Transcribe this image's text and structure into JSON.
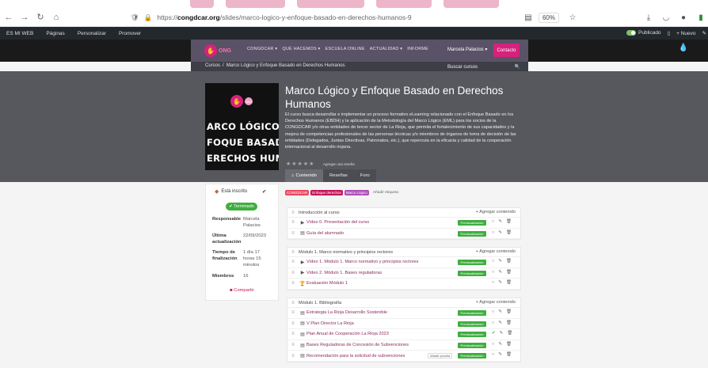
{
  "browser": {
    "url_prefix": "https://",
    "url_domain": "congdcar.org",
    "url_path": "/slides/marco-logico-y-enfoque-basado-en-derechos-humanos-9",
    "zoom": "60%"
  },
  "wpbar": {
    "site_item": "ES MI WEB",
    "items": [
      "Páginas",
      "Personalizar",
      "Promover"
    ],
    "published": "Publicado",
    "new_label": "+ Nuevo"
  },
  "header": {
    "logo_text": "ONG",
    "menu": [
      "CONGDCAR ▾",
      "QUÉ HACEMOS ▾",
      "ESCUELA ONLINE",
      "ACTUALIDAD ▾",
      "INFORME"
    ],
    "user": "Marcela Palacios ▾",
    "contact": "Contacto"
  },
  "breadcrumb": {
    "root": "Cursos",
    "sep": "/",
    "current": "Marco Lógico y Enfoque Basado en Derechos Humanos"
  },
  "search": {
    "placeholder": "Buscar cursos"
  },
  "cover": {
    "logo_text": "ONG",
    "line1": "ARCO LÓGICO",
    "line2": "FOQUE BASADO",
    "line3": "ERECHOS HUMAN"
  },
  "course": {
    "title": "Marco Lógico y Enfoque Basado en Derechos Humanos",
    "description": "El curso busca desarrollar e implementar un proceso formativo eLearning relacionado con el Enfoque Basado en los Derechos Humanos (EBDH) y la aplicación de la Metodología del Marco Lógico (EML) para los socios de la CONGDCAR y/o otras entidades de tercer sector de La Rioja, que permita el fortalecimiento de sus capacidades y la mejora de competencias profesionales de las personas técnicas y/o miembros de órganos de toma de decisión de las entidades (Delegados, Juntas Directivas, Patronatos, etc.), que repercuta en la eficacia y calidad de la cooperación internacional al desarrollo riojana.",
    "rate_label": "Agregar una reseña",
    "tabs": [
      "Contenido",
      "Reseñas",
      "Foro"
    ]
  },
  "sidebar": {
    "enrolled": "Está inscrito",
    "done": "✔ Terminado",
    "rows": [
      {
        "key": "Responsable",
        "value": "Marcela Palacios"
      },
      {
        "key": "Última actualización",
        "value": "22/09/2023"
      },
      {
        "key": "Tiempo de finalización",
        "value": "1 día 17 horas 15 minutos"
      },
      {
        "key": "Miembros",
        "value": "16"
      }
    ],
    "share": "Compartir"
  },
  "tags": {
    "items": [
      {
        "label": "CONGDCAR",
        "color": "#e84a5f"
      },
      {
        "label": "Enfoque derechos",
        "color": "#c2185b"
      },
      {
        "label": "Marco Lógico",
        "color": "#ad4fb8"
      }
    ],
    "add": "Añadir etiqueta"
  },
  "modules": [
    {
      "title": "Introducción al curso",
      "add": "Agregar contenido",
      "items": [
        {
          "type": "video",
          "label": "Vídeo 0. Presentación del curso"
        },
        {
          "type": "doc",
          "label": "Guía del alumnado"
        }
      ]
    },
    {
      "title": "Módulo 1. Marco normativo y principios rectores",
      "add": "Agregar contenido",
      "items": [
        {
          "type": "video",
          "label": "Vídeo 1. Módulo 1. Marco normativo y principios rectores"
        },
        {
          "type": "video",
          "label": "Vídeo 2. Módulo 1. Bases reguladoras"
        },
        {
          "type": "quiz",
          "label": "Evaluación Módulo 1"
        }
      ]
    },
    {
      "title": "Módulo 1. Bibliografía",
      "add": "Agregar contenido",
      "items": [
        {
          "type": "doc",
          "label": "Estrategia La Rioja Desarrollo Sostenible"
        },
        {
          "type": "doc",
          "label": "V Plan Director La Rioja"
        },
        {
          "type": "doc",
          "label": "Plan Anual de Cooperación La Rioja 2023",
          "done": true
        },
        {
          "type": "doc",
          "label": "Bases Reguladoras de Concesión de Subvenciones"
        },
        {
          "type": "doc",
          "label": "Recomendación para la solicitud de subvenciones",
          "add_preview": "Añadir prueba"
        }
      ]
    }
  ],
  "preview_label": "Previsualización"
}
